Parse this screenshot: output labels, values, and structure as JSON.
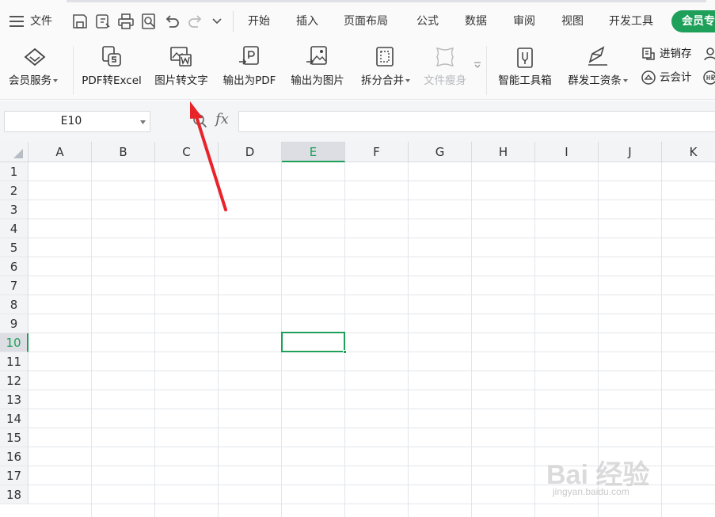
{
  "menubar": {
    "file_label": "文件",
    "tabs": [
      "开始",
      "插入",
      "页面布局",
      "公式",
      "数据",
      "审阅",
      "视图",
      "开发工具"
    ],
    "member_label": "会员专"
  },
  "ribbon": {
    "member_service": "会员服务",
    "pdf_to_excel": "PDF转Excel",
    "image_to_text": "图片转文字",
    "export_pdf": "输出为PDF",
    "export_image": "输出为图片",
    "split_merge": "拆分合并",
    "file_slim": "文件瘦身",
    "smart_toolbox": "智能工具箱",
    "mass_payroll": "群发工资条",
    "inventory": "进销存",
    "cloud_accounting": "云会计"
  },
  "formula_bar": {
    "cell_ref": "E10",
    "fx_label": "fx",
    "formula": ""
  },
  "sheet": {
    "columns": [
      "A",
      "B",
      "C",
      "D",
      "E",
      "F",
      "G",
      "H",
      "I",
      "J",
      "K"
    ],
    "rows": [
      "1",
      "2",
      "3",
      "4",
      "5",
      "6",
      "7",
      "8",
      "9",
      "10",
      "11",
      "12",
      "13",
      "14",
      "15",
      "16",
      "17",
      "18"
    ],
    "active_column": "E",
    "active_row": "10"
  },
  "colors": {
    "accent": "#1ea05a",
    "annotation_arrow": "#e8232a"
  },
  "watermark": {
    "brand": "Bai 经验",
    "url": "jingyan.baidu.com"
  }
}
